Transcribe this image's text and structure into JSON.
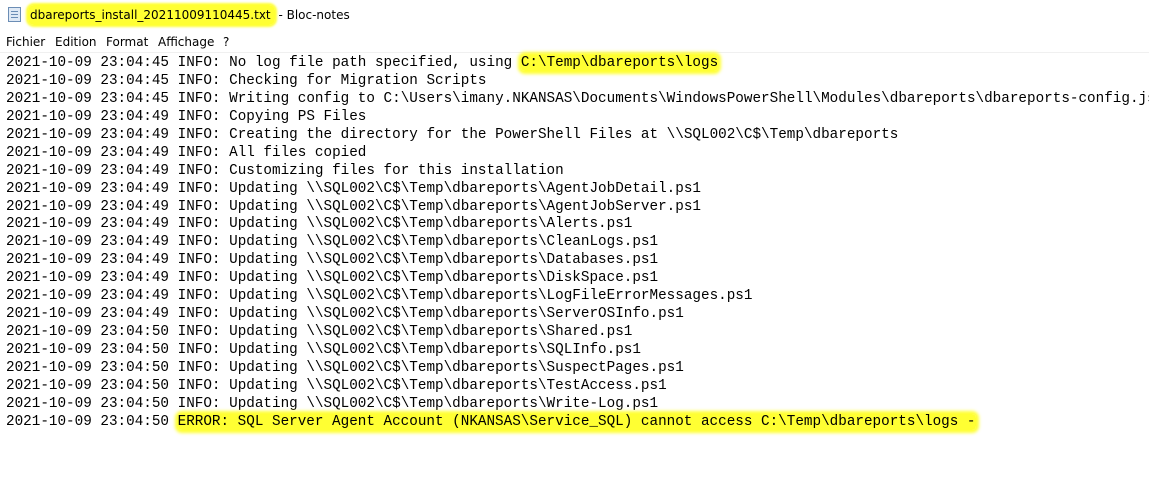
{
  "window": {
    "file_name": "dbareports_install_20211009110445.txt",
    "app_suffix": " - Bloc-notes",
    "icon": "notepad-icon"
  },
  "menu": [
    "Fichier",
    "Edition",
    "Format",
    "Affichage",
    "?"
  ],
  "highlight_color": "#ffff33",
  "log_lines": [
    {
      "ts": "2021-10-09 23:04:45",
      "level": "INFO:",
      "msg": "No log file path specified, using ",
      "hl": "C:\\Temp\\dbareports\\logs"
    },
    {
      "ts": "2021-10-09 23:04:45",
      "level": "INFO:",
      "msg": "Checking for Migration Scripts",
      "hl": ""
    },
    {
      "ts": "2021-10-09 23:04:45",
      "level": "INFO:",
      "msg": "Writing config to C:\\Users\\imany.NKANSAS\\Documents\\WindowsPowerShell\\Modules\\dbareports\\dbareports-config.json",
      "hl": ""
    },
    {
      "ts": "2021-10-09 23:04:49",
      "level": "INFO:",
      "msg": "Copying PS Files",
      "hl": ""
    },
    {
      "ts": "2021-10-09 23:04:49",
      "level": "INFO:",
      "msg": "Creating the directory for the PowerShell Files at \\\\SQL002\\C$\\Temp\\dbareports",
      "hl": ""
    },
    {
      "ts": "2021-10-09 23:04:49",
      "level": "INFO:",
      "msg": "All files copied",
      "hl": ""
    },
    {
      "ts": "2021-10-09 23:04:49",
      "level": "INFO:",
      "msg": "Customizing files for this installation",
      "hl": ""
    },
    {
      "ts": "2021-10-09 23:04:49",
      "level": "INFO:",
      "msg": "Updating \\\\SQL002\\C$\\Temp\\dbareports\\AgentJobDetail.ps1",
      "hl": ""
    },
    {
      "ts": "2021-10-09 23:04:49",
      "level": "INFO:",
      "msg": "Updating \\\\SQL002\\C$\\Temp\\dbareports\\AgentJobServer.ps1",
      "hl": ""
    },
    {
      "ts": "2021-10-09 23:04:49",
      "level": "INFO:",
      "msg": "Updating \\\\SQL002\\C$\\Temp\\dbareports\\Alerts.ps1",
      "hl": ""
    },
    {
      "ts": "2021-10-09 23:04:49",
      "level": "INFO:",
      "msg": "Updating \\\\SQL002\\C$\\Temp\\dbareports\\CleanLogs.ps1",
      "hl": ""
    },
    {
      "ts": "2021-10-09 23:04:49",
      "level": "INFO:",
      "msg": "Updating \\\\SQL002\\C$\\Temp\\dbareports\\Databases.ps1",
      "hl": ""
    },
    {
      "ts": "2021-10-09 23:04:49",
      "level": "INFO:",
      "msg": "Updating \\\\SQL002\\C$\\Temp\\dbareports\\DiskSpace.ps1",
      "hl": ""
    },
    {
      "ts": "2021-10-09 23:04:49",
      "level": "INFO:",
      "msg": "Updating \\\\SQL002\\C$\\Temp\\dbareports\\LogFileErrorMessages.ps1",
      "hl": ""
    },
    {
      "ts": "2021-10-09 23:04:49",
      "level": "INFO:",
      "msg": "Updating \\\\SQL002\\C$\\Temp\\dbareports\\ServerOSInfo.ps1",
      "hl": ""
    },
    {
      "ts": "2021-10-09 23:04:50",
      "level": "INFO:",
      "msg": "Updating \\\\SQL002\\C$\\Temp\\dbareports\\Shared.ps1",
      "hl": ""
    },
    {
      "ts": "2021-10-09 23:04:50",
      "level": "INFO:",
      "msg": "Updating \\\\SQL002\\C$\\Temp\\dbareports\\SQLInfo.ps1",
      "hl": ""
    },
    {
      "ts": "2021-10-09 23:04:50",
      "level": "INFO:",
      "msg": "Updating \\\\SQL002\\C$\\Temp\\dbareports\\SuspectPages.ps1",
      "hl": ""
    },
    {
      "ts": "2021-10-09 23:04:50",
      "level": "INFO:",
      "msg": "Updating \\\\SQL002\\C$\\Temp\\dbareports\\TestAccess.ps1",
      "hl": ""
    },
    {
      "ts": "2021-10-09 23:04:50",
      "level": "INFO:",
      "msg": "Updating \\\\SQL002\\C$\\Temp\\dbareports\\Write-Log.ps1",
      "hl": ""
    },
    {
      "ts": "2021-10-09 23:04:50",
      "level": "",
      "msg": "",
      "hl": "ERROR: SQL Server Agent Account (NKANSAS\\Service_SQL) cannot access C:\\Temp\\dbareports\\logs -"
    }
  ]
}
